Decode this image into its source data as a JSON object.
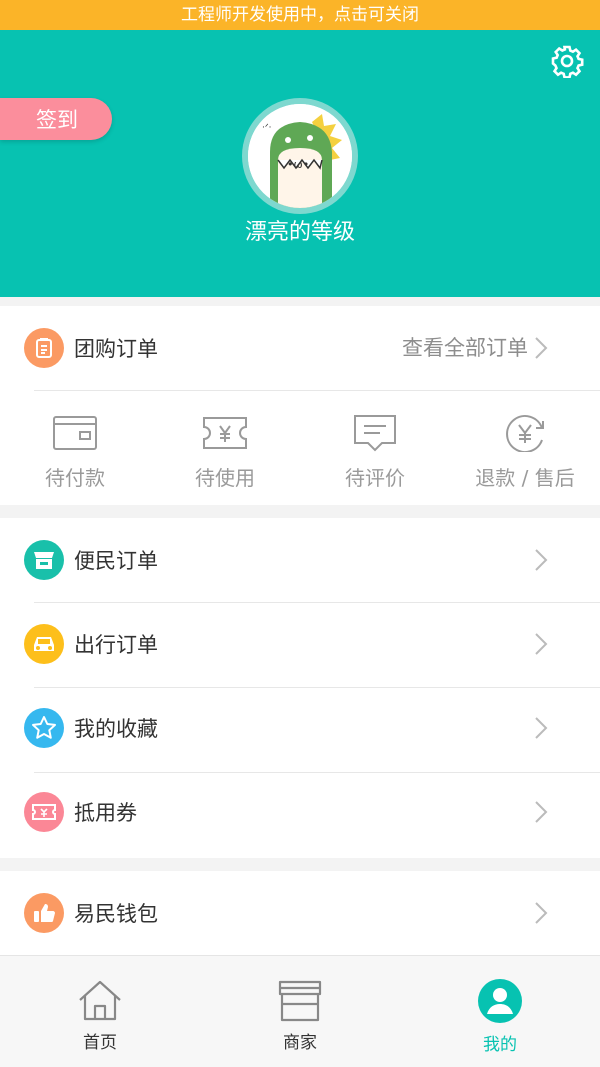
{
  "dev_banner": "工程师开发使用中，点击可关闭",
  "header": {
    "checkin_label": "签到",
    "level_name": "漂亮的等级",
    "background_color": "#07c2b1",
    "settings_icon": "gear-icon"
  },
  "group_orders": {
    "title": "团购订单",
    "view_all": "查看全部订单",
    "statuses": [
      {
        "label": "待付款",
        "icon": "wallet-icon"
      },
      {
        "label": "待使用",
        "icon": "ticket-yen-icon"
      },
      {
        "label": "待评价",
        "icon": "comment-icon"
      },
      {
        "label": "退款 / 售后",
        "icon": "refund-yen-icon"
      }
    ]
  },
  "menu": [
    {
      "label": "便民订单",
      "icon": "shop-icon",
      "color": "#19c0aa"
    },
    {
      "label": "出行订单",
      "icon": "car-icon",
      "color": "#fdbf1b"
    },
    {
      "label": "我的收藏",
      "icon": "star-icon",
      "color": "#36b8ef"
    },
    {
      "label": "抵用券",
      "icon": "coupon-icon",
      "color": "#fb8796"
    }
  ],
  "wallet": {
    "label": "易民钱包",
    "icon": "thumbs-up-icon",
    "color": "#fb9a63"
  },
  "tabbar": [
    {
      "label": "首页",
      "icon": "home-icon",
      "active": false
    },
    {
      "label": "商家",
      "icon": "store-icon",
      "active": false
    },
    {
      "label": "我的",
      "icon": "user-icon",
      "active": true
    }
  ],
  "colors": {
    "accent": "#07c2b1",
    "banner": "#fbb428",
    "checkin": "#fb8e9c"
  }
}
